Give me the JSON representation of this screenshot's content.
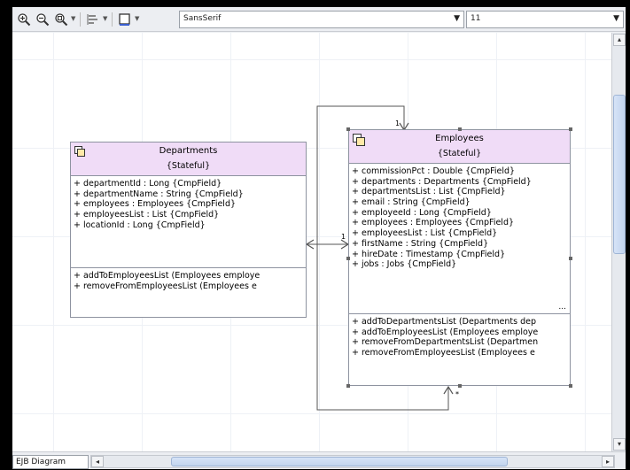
{
  "toolbar": {
    "font_name": "SansSerif",
    "font_size": "11",
    "icons": [
      "zoom-in-icon",
      "zoom-out-icon",
      "zoom-fit-icon",
      "align-icon",
      "color-icon"
    ]
  },
  "diagram": {
    "departments": {
      "name": "Departments",
      "stereotype": "{Stateful}",
      "fields": [
        "+ departmentId  : Long {CmpField}",
        "+ departmentName  : String {CmpField}",
        "+ employees  : Employees {CmpField}",
        "+ employeesList  : List {CmpField}",
        "+ locationId  : Long {CmpField}"
      ],
      "methods": [
        "+ addToEmployeesList (Employees employe",
        "+ removeFromEmployeesList (Employees e"
      ]
    },
    "employees": {
      "name": "Employees",
      "stereotype": "{Stateful}",
      "fields": [
        "+ commissionPct  : Double {CmpField}",
        "+ departments  : Departments {CmpField}",
        "+ departmentsList  : List {CmpField}",
        "+ email  : String {CmpField}",
        "+ employeeId  : Long {CmpField}",
        "+ employees  : Employees {CmpField}",
        "+ employeesList  : List {CmpField}",
        "+ firstName  : String {CmpField}",
        "+ hireDate  : Timestamp {CmpField}",
        "+ jobs  : Jobs {CmpField}"
      ],
      "more": "...",
      "methods": [
        "+ addToDepartmentsList (Departments dep",
        "+ addToEmployeesList (Employees employe",
        "+ removeFromDepartmentsList (Departmen",
        "+ removeFromEmployeesList (Employees e"
      ]
    },
    "multiplicity_top": "1",
    "multiplicity_mid": "1",
    "multiplicity_bottom": "*"
  },
  "footer": {
    "tab": "EJB Diagram",
    "scroll_left": "◂",
    "scroll_right": "▸",
    "scroll_up": "▴",
    "scroll_down": "▾"
  },
  "colors": {
    "entity_header": "#f0dcf7",
    "scroll_thumb": "#c2d4ee"
  }
}
